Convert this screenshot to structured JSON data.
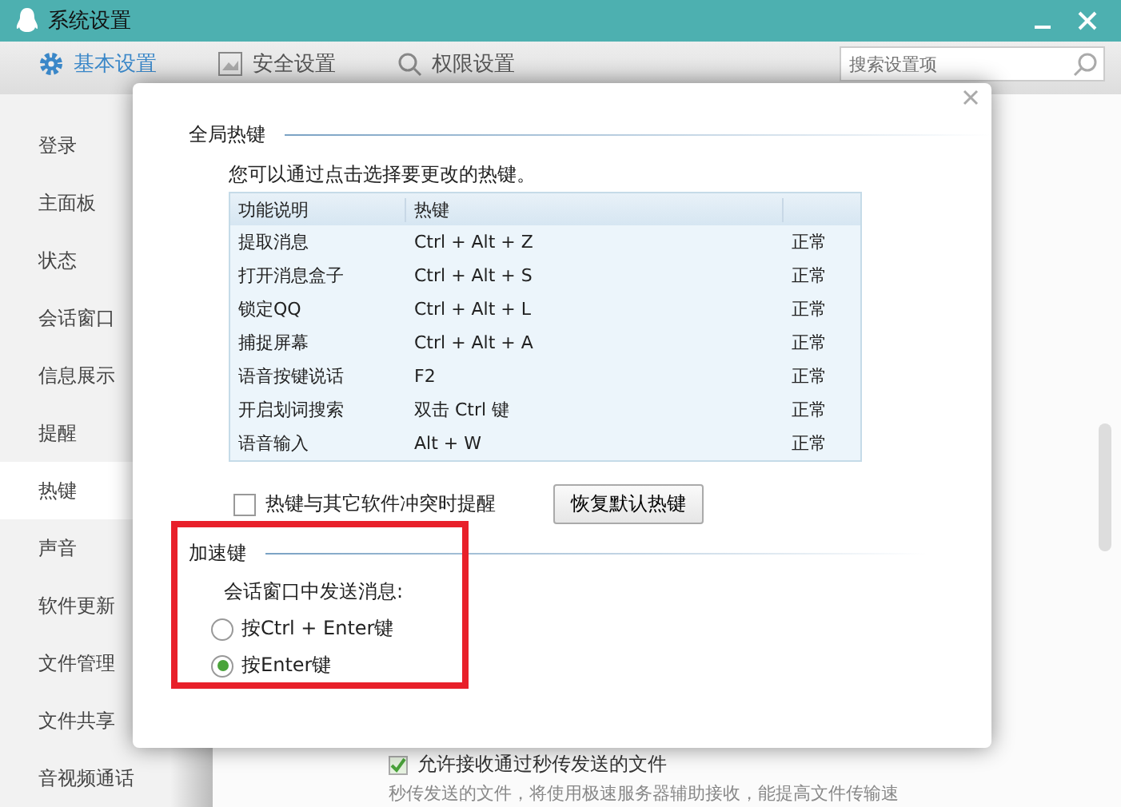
{
  "window": {
    "title": "系统设置"
  },
  "tabs": [
    {
      "label": "基本设置",
      "selected": true
    },
    {
      "label": "安全设置",
      "selected": false
    },
    {
      "label": "权限设置",
      "selected": false
    }
  ],
  "search": {
    "placeholder": "搜索设置项"
  },
  "sidebar": {
    "items": [
      {
        "label": "登录",
        "selected": false
      },
      {
        "label": "主面板",
        "selected": false
      },
      {
        "label": "状态",
        "selected": false
      },
      {
        "label": "会话窗口",
        "selected": false
      },
      {
        "label": "信息展示",
        "selected": false
      },
      {
        "label": "提醒",
        "selected": false
      },
      {
        "label": "热键",
        "selected": true
      },
      {
        "label": "声音",
        "selected": false
      },
      {
        "label": "软件更新",
        "selected": false
      },
      {
        "label": "文件管理",
        "selected": false
      },
      {
        "label": "文件共享",
        "selected": false
      },
      {
        "label": "音视频通话",
        "selected": false
      }
    ]
  },
  "background_option": {
    "label": "允许接收通过秒传发送的文件",
    "checked": true,
    "note": "秒传发送的文件，将使用极速服务器辅助接收，能提高文件传输速"
  },
  "dialog": {
    "global_hotkeys": {
      "title": "全局热键",
      "description": "您可以通过点击选择要更改的热键。",
      "table": {
        "columns": [
          "功能说明",
          "热键"
        ],
        "rows": [
          {
            "function": "提取消息",
            "hotkey": "Ctrl + Alt + Z",
            "status": "正常"
          },
          {
            "function": "打开消息盒子",
            "hotkey": "Ctrl + Alt + S",
            "status": "正常"
          },
          {
            "function": "锁定QQ",
            "hotkey": "Ctrl + Alt + L",
            "status": "正常"
          },
          {
            "function": "捕捉屏幕",
            "hotkey": "Ctrl + Alt + A",
            "status": "正常"
          },
          {
            "function": "语音按键说话",
            "hotkey": "F2",
            "status": "正常"
          },
          {
            "function": "开启划词搜索",
            "hotkey": "双击 Ctrl 键",
            "status": "正常"
          },
          {
            "function": "语音输入",
            "hotkey": "Alt + W",
            "status": "正常"
          }
        ]
      },
      "conflict_checkbox": {
        "label": "热键与其它软件冲突时提醒",
        "checked": false
      },
      "restore_button": "恢复默认热键"
    },
    "accelerator": {
      "title": "加速键",
      "prompt": "会话窗口中发送消息:",
      "options": [
        {
          "label": "按Ctrl + Enter键",
          "selected": false
        },
        {
          "label": "按Enter键",
          "selected": true
        }
      ]
    }
  }
}
